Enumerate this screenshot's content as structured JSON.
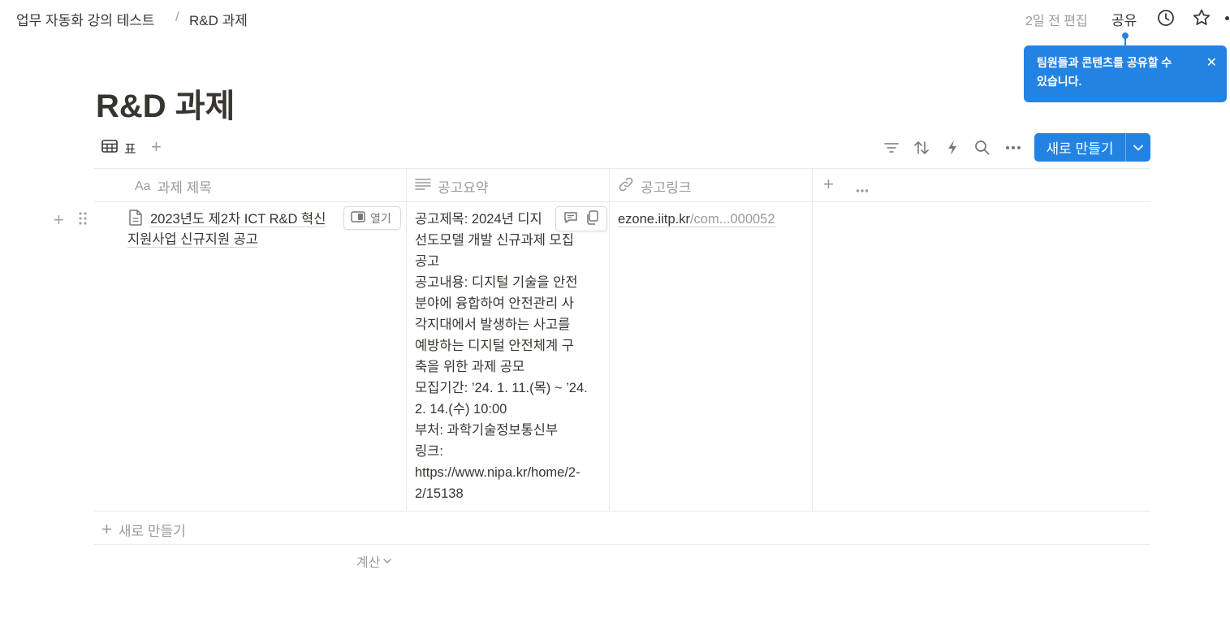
{
  "topbar": {
    "breadcrumb": [
      "업무 자동화 강의 테스트",
      "R&D 과제"
    ],
    "breadcrumb_sep": "/",
    "edited": "2일 전 편집",
    "share": "공유"
  },
  "tooltip": {
    "line1": "팀원들과 콘텐츠를 공유할 수",
    "line2": "있습니다.",
    "close": "✕"
  },
  "page": {
    "title": "R&D 과제"
  },
  "view": {
    "tab_label": "표",
    "new_button": "새로 만들기"
  },
  "table": {
    "columns": [
      {
        "label": "과제 제목",
        "icon": "Aa"
      },
      {
        "label": "공고요약"
      },
      {
        "label": "공고링크"
      }
    ],
    "rows": [
      {
        "title_line1": "2023년도 제2차 ICT R&D 혁신",
        "title_line2": "지원사업 신규지원 공고",
        "open_label": "열기",
        "summary": [
          "공고제목: 2024년 디지",
          "선도모델 개발 신규과제 모집",
          "공고",
          "공고내용: 디지털 기술을 안전",
          "분야에 융합하여 안전관리 사",
          "각지대에서 발생하는 사고를",
          "예방하는 디지털 안전체계 구",
          "축을 위한 과제 공모",
          "모집기간: ’24. 1. 11.(목) ~ ’24.",
          "2. 14.(수) 10:00",
          "부처: 과학기술정보통신부",
          "링크:",
          "https://www.nipa.kr/home/2-",
          "2/15138"
        ],
        "link_domain": "ezone.iitp.kr",
        "link_rest": "/com...000052"
      }
    ],
    "new_row": "새로 만들기",
    "calc": "계산"
  },
  "colors": {
    "accent": "#2383e2",
    "text": "#37352f",
    "muted": "#9b9a97",
    "border": "#e9e9e7"
  }
}
